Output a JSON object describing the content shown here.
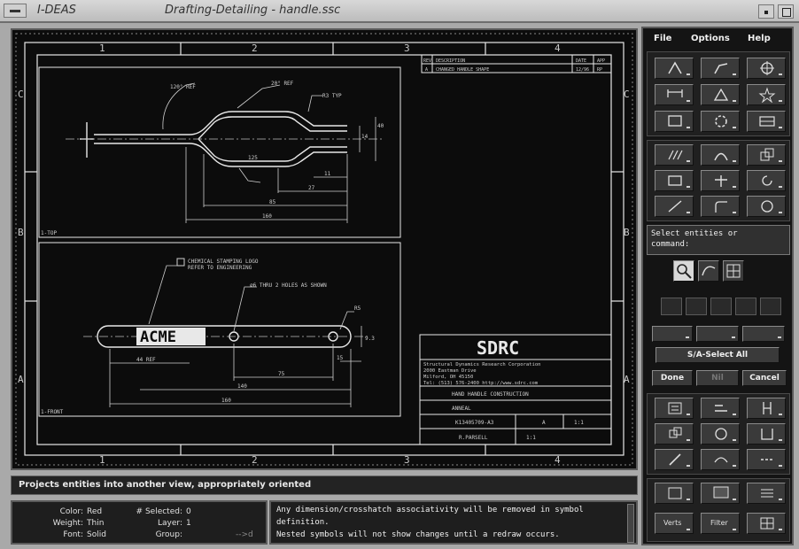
{
  "window": {
    "app_name": "I-DEAS",
    "title": "Drafting-Detailing - handle.ssc"
  },
  "drawing": {
    "zone_columns": [
      "1",
      "2",
      "3",
      "4"
    ],
    "zone_rows": [
      "C",
      "B",
      "A"
    ],
    "top_view_label": "1-TOP",
    "front_view_label": "1-FRONT",
    "top_view_dims": [
      "120° REF",
      "20° REF",
      "R3 TYP",
      "14",
      "40",
      "125",
      "11",
      "27",
      "85",
      "160"
    ],
    "front_view_dims": [
      "44 REF",
      "75",
      "140",
      "160",
      "R5",
      "9.3",
      "15",
      "⌀6 THRU 2 HOLES AS SHOWN"
    ],
    "note_1": "CHEMICAL STAMPING LOGO",
    "note_1b": "REFER TO ENGINEERING",
    "logo_text": "ACME",
    "title_block": {
      "company_logo": "SDRC",
      "company_lines": [
        "Structural Dynamics Research Corporation",
        "2000 Eastman Drive",
        "Milford, OH 45150",
        "Tel: (513) 576-2400   http://www.sdrc.com"
      ],
      "title": "HAND HANDLE CONSTRUCTION",
      "material": "ANNEAL",
      "drawing_no": "K13405709-A3",
      "size": "A",
      "scale": "1:1",
      "sheet": "1:1",
      "drawn": "R.PARSELL",
      "rev": "A",
      "revision_row": [
        "A",
        "CHANGED HANDLE SHAPE",
        "12/96",
        "RP"
      ],
      "revision_headers": [
        "REV",
        "DESCRIPTION",
        "DATE",
        "APP"
      ]
    }
  },
  "status": {
    "prompt_message": "Projects entities into another view, appropriately oriented"
  },
  "attributes": {
    "color_label": "Color:",
    "color_value": "Red",
    "weight_label": "Weight:",
    "weight_value": "Thin",
    "font_label": "Font:",
    "font_value": "Solid",
    "selected_label": "# Selected:",
    "selected_value": "0",
    "layer_label": "Layer:",
    "layer_value": "1",
    "group_label": "Group:",
    "group_value": "",
    "extra": "-->d"
  },
  "messages": [
    "Any dimension/crosshatch associativity will be removed in symbol",
    "  definition.",
    "Nested symbols will not show changes until a redraw occurs."
  ],
  "panel": {
    "menus": [
      "File",
      "Options",
      "Help"
    ],
    "prompt_text": "Select entities or\ncommand:",
    "select_all_label": "S/A-Select All",
    "done_label": "Done",
    "nil_label": "Nil",
    "cancel_label": "Cancel",
    "bottom_labels": [
      "Verts",
      "Filter"
    ]
  },
  "colors": {
    "background": "#0c0c0c",
    "drawing_line": "#e8e8e8",
    "panel": "#141414"
  }
}
